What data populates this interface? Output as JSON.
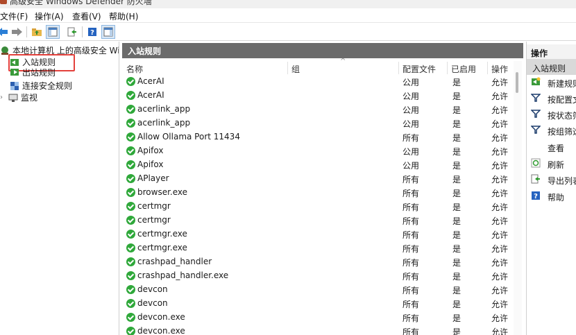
{
  "title_text": "高级安全 Windows Defender 防火墙",
  "menu": [
    "文件(F)",
    "操作(A)",
    "查看(V)",
    "帮助(H)"
  ],
  "toolbar": {
    "buttons": [
      "back-arrow-icon",
      "forward-arrow-icon",
      "folder-up-icon",
      "show-hide-tree-icon",
      "export-icon",
      "help-icon",
      "show-hide-action-pane-icon"
    ]
  },
  "tree": {
    "root": "本地计算机 上的高级安全 Windows Defender 防火墙",
    "inbound": "入站规则",
    "outbound": "出站规则",
    "connection": "连接安全规则",
    "monitor": "监视"
  },
  "center": {
    "title": "入站规则",
    "columns": {
      "name": "名称",
      "group": "组",
      "profile": "配置文件",
      "enabled": "已启用",
      "action": "操作"
    },
    "rows": [
      {
        "name": "AcerAI",
        "group": "",
        "profile": "公用",
        "enabled": "是",
        "action": "允许"
      },
      {
        "name": "AcerAI",
        "group": "",
        "profile": "公用",
        "enabled": "是",
        "action": "允许"
      },
      {
        "name": "acerlink_app",
        "group": "",
        "profile": "公用",
        "enabled": "是",
        "action": "允许"
      },
      {
        "name": "acerlink_app",
        "group": "",
        "profile": "公用",
        "enabled": "是",
        "action": "允许"
      },
      {
        "name": "Allow Ollama Port 11434",
        "group": "",
        "profile": "所有",
        "enabled": "是",
        "action": "允许"
      },
      {
        "name": "Apifox",
        "group": "",
        "profile": "公用",
        "enabled": "是",
        "action": "允许"
      },
      {
        "name": "Apifox",
        "group": "",
        "profile": "公用",
        "enabled": "是",
        "action": "允许"
      },
      {
        "name": "APlayer",
        "group": "",
        "profile": "所有",
        "enabled": "是",
        "action": "允许"
      },
      {
        "name": "browser.exe",
        "group": "",
        "profile": "所有",
        "enabled": "是",
        "action": "允许"
      },
      {
        "name": "certmgr",
        "group": "",
        "profile": "所有",
        "enabled": "是",
        "action": "允许"
      },
      {
        "name": "certmgr",
        "group": "",
        "profile": "所有",
        "enabled": "是",
        "action": "允许"
      },
      {
        "name": "certmgr.exe",
        "group": "",
        "profile": "所有",
        "enabled": "是",
        "action": "允许"
      },
      {
        "name": "certmgr.exe",
        "group": "",
        "profile": "所有",
        "enabled": "是",
        "action": "允许"
      },
      {
        "name": "crashpad_handler",
        "group": "",
        "profile": "所有",
        "enabled": "是",
        "action": "允许"
      },
      {
        "name": "crashpad_handler.exe",
        "group": "",
        "profile": "所有",
        "enabled": "是",
        "action": "允许"
      },
      {
        "name": "devcon",
        "group": "",
        "profile": "所有",
        "enabled": "是",
        "action": "允许"
      },
      {
        "name": "devcon",
        "group": "",
        "profile": "所有",
        "enabled": "是",
        "action": "允许"
      },
      {
        "name": "devcon.exe",
        "group": "",
        "profile": "所有",
        "enabled": "是",
        "action": "允许"
      },
      {
        "name": "devcon.exe",
        "group": "",
        "profile": "所有",
        "enabled": "是",
        "action": "允许"
      }
    ]
  },
  "actions": {
    "title": "操作",
    "section": "入站规则",
    "items": [
      "新建规则...",
      "按配置文件筛选",
      "按状态筛选",
      "按组筛选",
      "查看",
      "刷新",
      "导出列表...",
      "帮助"
    ]
  },
  "colors": {
    "accent_check": "#2fa83a",
    "pane_header": "#6b6b6b",
    "highlight": "#e3403b"
  }
}
